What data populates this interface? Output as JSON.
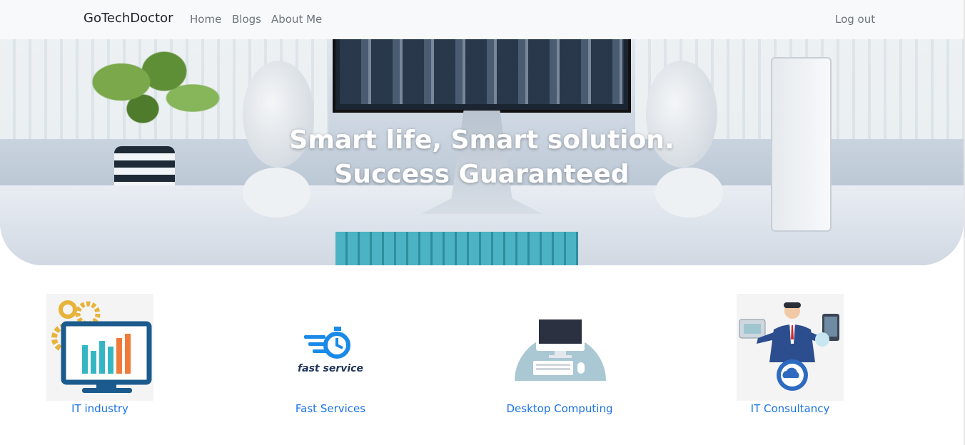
{
  "navbar": {
    "brand": "GoTechDoctor",
    "links": [
      "Home",
      "Blogs",
      "About Me"
    ],
    "logout": "Log out"
  },
  "hero": {
    "line1": "Smart life, Smart solution.",
    "line2": "Success Guaranteed"
  },
  "services": [
    {
      "label": "IT industry",
      "icon": "it-industry-icon"
    },
    {
      "label": "Fast Services",
      "icon": "fast-service-icon",
      "icon_text": "fast service"
    },
    {
      "label": "Desktop Computing",
      "icon": "desktop-computer-icon"
    },
    {
      "label": "IT Consultancy",
      "icon": "consultant-icon"
    }
  ],
  "colors": {
    "link": "#1a73e8",
    "navbar_bg": "#f8f9fa",
    "brand_text": "#212529",
    "nav_text": "#6c757d"
  }
}
